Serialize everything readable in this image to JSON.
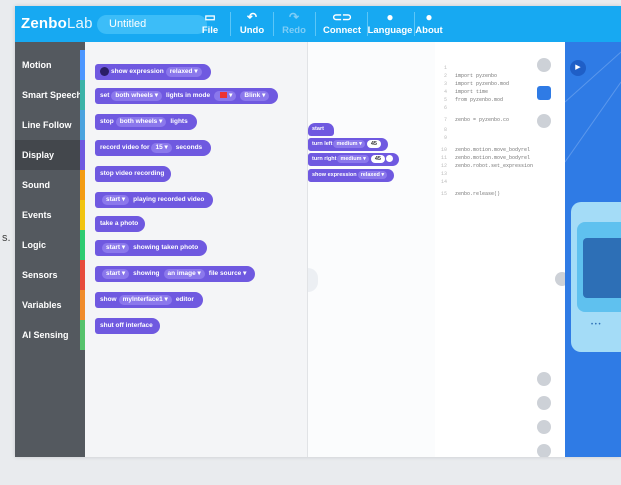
{
  "stray_text": "s.",
  "app": {
    "logo_main": "Zenbo",
    "logo_sub": "Lab",
    "project_name": "Untitled"
  },
  "toolbar": {
    "file": "File",
    "undo": "Undo",
    "redo": "Redo",
    "connect": "Connect",
    "language": "Language",
    "about": "About"
  },
  "categories": [
    {
      "label": "Motion",
      "color": "#4c97ff"
    },
    {
      "label": "Smart Speech",
      "color": "#3bb3a8"
    },
    {
      "label": "Line Follow",
      "color": "#4aa3df"
    },
    {
      "label": "Display",
      "color": "#6f59e0"
    },
    {
      "label": "Sound",
      "color": "#f39c12"
    },
    {
      "label": "Events",
      "color": "#f1c40f"
    },
    {
      "label": "Logic",
      "color": "#2ecc71"
    },
    {
      "label": "Sensors",
      "color": "#e74c3c"
    },
    {
      "label": "Variables",
      "color": "#f08c2b"
    },
    {
      "label": "AI Sensing",
      "color": "#55c26b"
    }
  ],
  "flyout_blocks": {
    "b1": {
      "main": "show expression",
      "opt": "relaxed ▾"
    },
    "b2": {
      "a": "set",
      "opt1": "both wheels ▾",
      "b": "lights in mode",
      "opt2": "▾",
      "opt3": "Blink ▾"
    },
    "b3": {
      "a": "stop",
      "opt1": "both wheels ▾",
      "b": "lights"
    },
    "b4": {
      "a": "record video for",
      "opt1": "15 ▾",
      "b": "seconds"
    },
    "b5": {
      "a": "stop video recording"
    },
    "b6": {
      "opt1": "start ▾",
      "b": "playing recorded video"
    },
    "b7": {
      "a": "take a photo"
    },
    "b8": {
      "opt1": "start ▾",
      "b": "showing taken photo"
    },
    "b9": {
      "opt1": "start ▾",
      "b": "showing",
      "opt2": "an image ▾",
      "c": "file source ▾"
    },
    "b10": {
      "a": "show",
      "opt1": "myInterface1 ▾",
      "b": "editor"
    },
    "b11": {
      "a": "shut off interface"
    }
  },
  "workspace_blocks": {
    "w1": {
      "a": "start"
    },
    "w2": {
      "a": "turn left",
      "opt1": "medium ▾",
      "val": "45"
    },
    "w3": {
      "a": "turn right",
      "opt1": "medium ▾",
      "val": "45"
    },
    "w4": {
      "a": "show expression",
      "opt1": "relaxed ▾"
    }
  },
  "code_lines": [
    {
      "n": "1",
      "t": ""
    },
    {
      "n": "2",
      "t": "import pyzenbo"
    },
    {
      "n": "3",
      "t": "import pyzenbo.mod"
    },
    {
      "n": "4",
      "t": "import time"
    },
    {
      "n": "5",
      "t": "from pyzenbo.mod"
    },
    {
      "n": "6",
      "t": ""
    },
    {
      "n": "7",
      "t": "zenbo = pyzenbo.co"
    },
    {
      "n": "8",
      "t": ""
    },
    {
      "n": "9",
      "t": ""
    },
    {
      "n": "10",
      "t": "zenbo.motion.move_bodyrel"
    },
    {
      "n": "11",
      "t": "zenbo.motion.move_bodyrel"
    },
    {
      "n": "12",
      "t": "zenbo.robot.set_expression"
    },
    {
      "n": "13",
      "t": ""
    },
    {
      "n": "14",
      "t": ""
    },
    {
      "n": "15",
      "t": "zenbo.release()"
    }
  ],
  "colors": {
    "topbar": "#17a9f2",
    "sidebar": "#54595f",
    "display_block": "#6f59e0",
    "simulator": "#2f7be5"
  },
  "icons": {
    "file": "folder-icon",
    "undo": "undo-icon",
    "redo": "redo-icon",
    "connect": "link-icon",
    "language": "globe-icon",
    "about": "info-icon"
  }
}
